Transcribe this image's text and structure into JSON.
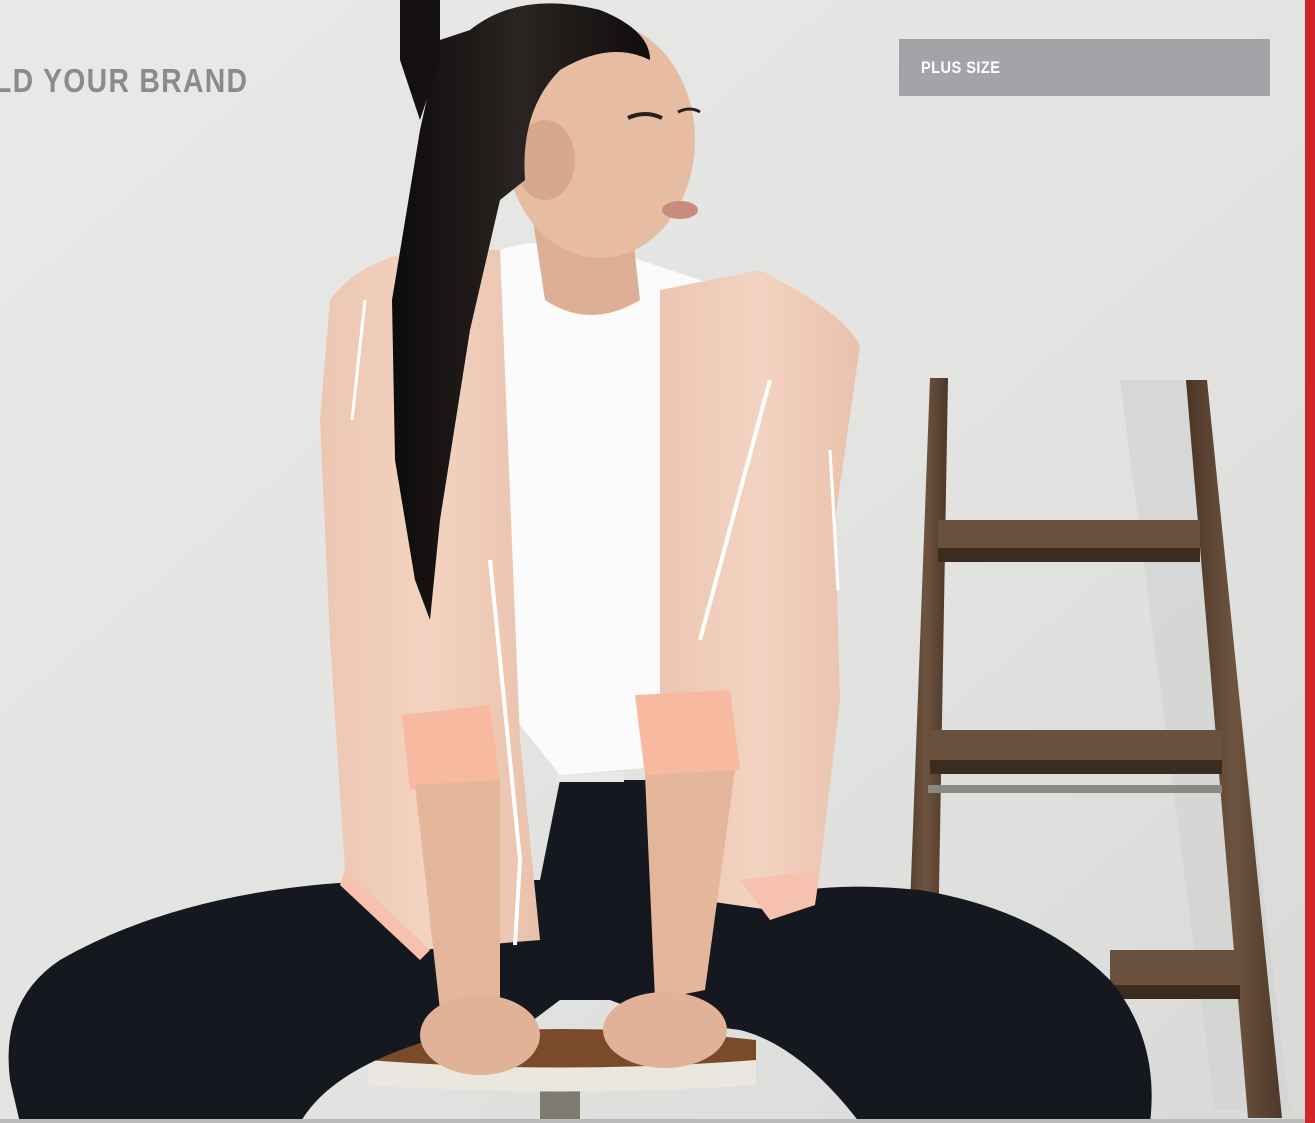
{
  "page": {
    "headline": "LD YOUR BRAND",
    "category_tag": "PLUS SIZE"
  },
  "photo": {
    "subject": "model-seated-on-stool-with-ladder",
    "colors": {
      "backdrop": "#e6e6e4",
      "jacket": "#f1cdb9",
      "jacket_cuff": "#f7b9a0",
      "tshirt": "#ffffff",
      "leggings": "#15181f",
      "hair": "#161312",
      "skin": "#e3b79e",
      "ladder_wood": "#5b4331",
      "stool_wood": "#7b4a2a"
    }
  },
  "theme": {
    "accent_bar": "#d3242a",
    "tag_background": "#a3a4a7",
    "headline_color": "#8a8b8d",
    "tag_text_color": "#ffffff"
  }
}
